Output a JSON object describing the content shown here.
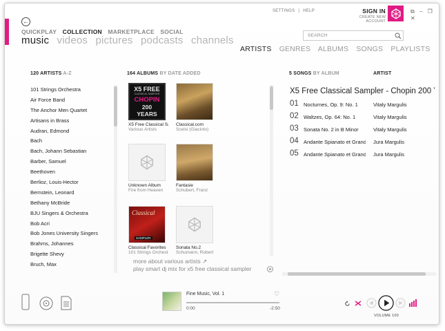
{
  "header": {
    "back_glyph": "←",
    "top_nav": [
      "QUICKPLAY",
      "COLLECTION",
      "MARKETPLACE",
      "SOCIAL"
    ],
    "sub_nav": [
      "music",
      "videos",
      "pictures",
      "podcasts",
      "channels"
    ],
    "settings_label": "SETTINGS",
    "separator": "|",
    "help_label": "HELP",
    "sign_in_label": "SIGN IN",
    "create_account_label": "CREATE NEW ACCOUNT",
    "search_placeholder": "SEARCH",
    "view_tabs": [
      "ARTISTS",
      "GENRES",
      "ALBUMS",
      "SONGS",
      "PLAYLISTS"
    ],
    "window_controls": [
      "⧉",
      "–",
      "❐",
      "✕"
    ],
    "accent_color": "#e01b84"
  },
  "artists": {
    "count_label": "120 ARTISTS",
    "sort_label": "A-Z",
    "items": [
      "101 Strings Orchestra",
      "Air Force Band",
      "The Anchor Men Quartet",
      "Artisans in Brass",
      "Audran, Edmond",
      "Bach",
      "Bach, Johann Sebastian",
      "Barber, Samuel",
      "Beethoven",
      "Berlioz, Louis-Hector",
      "Bernstein, Leonard",
      "Bethany McBride",
      "BJU Singers & Orchestra",
      "Bob Acri",
      "Bob Jones University Singers",
      "Brahms, Johannes",
      "Brigette Shevy",
      "Bruch, Max"
    ]
  },
  "albums": {
    "count_label": "164 ALBUMS",
    "sort_label": "BY DATE ADDED",
    "items": [
      {
        "title": "X5 Free Classical Sampler",
        "artist": "Various Artists"
      },
      {
        "title": "Classical.com",
        "artist": "Scelsi (Giacinto)"
      },
      {
        "title": "Unknown Album",
        "artist": "Fire from Heaven"
      },
      {
        "title": "Fantasie",
        "artist": "Schubert, Franz"
      },
      {
        "title": "Classical Favorites",
        "artist": "101 Strings Orchestra"
      },
      {
        "title": "Sonata No.2",
        "artist": "Schumann, Robert"
      }
    ],
    "cover_x5": {
      "line1": "X5 FREE",
      "line2": "CLASSICAL SAMPLER",
      "line3": "CHOPIN",
      "line4": "200 YEARS"
    },
    "cover_classical_label": "Classical",
    "cover_classical_sub": "SAMPLER",
    "more_about": "more about various artists ↗",
    "smart_dj": "play smart dj mix for x5 free classical sampler"
  },
  "songs": {
    "count_label": "5 SONGS",
    "sort_label": "BY ALBUM",
    "artist_header": "ARTIST",
    "album_title": "X5 Free Classical Sampler - Chopin 200 Years",
    "items": [
      {
        "num": "01",
        "title": "Nocturnes, Op. 9: No. 1",
        "artist": "Vitaly Margulis"
      },
      {
        "num": "02",
        "title": "Waltzes, Op. 64: No. 1",
        "artist": "Vitaly Margulis"
      },
      {
        "num": "03",
        "title": "Sonata No. 2 in B Minor",
        "artist": "Vitaly Margulis"
      },
      {
        "num": "04",
        "title": "Andante Spianato et Grande Polonaise",
        "artist": "Jura Margulis"
      },
      {
        "num": "05",
        "title": "Andante Spianato et Grande Polonaise",
        "artist": "Jura Margulis"
      }
    ]
  },
  "player": {
    "now_playing_title": "Fine Music, Vol. 1",
    "elapsed": "0:00",
    "remaining": "-2:50",
    "volume_label": "VOLUME 100",
    "progress": 0.0
  }
}
